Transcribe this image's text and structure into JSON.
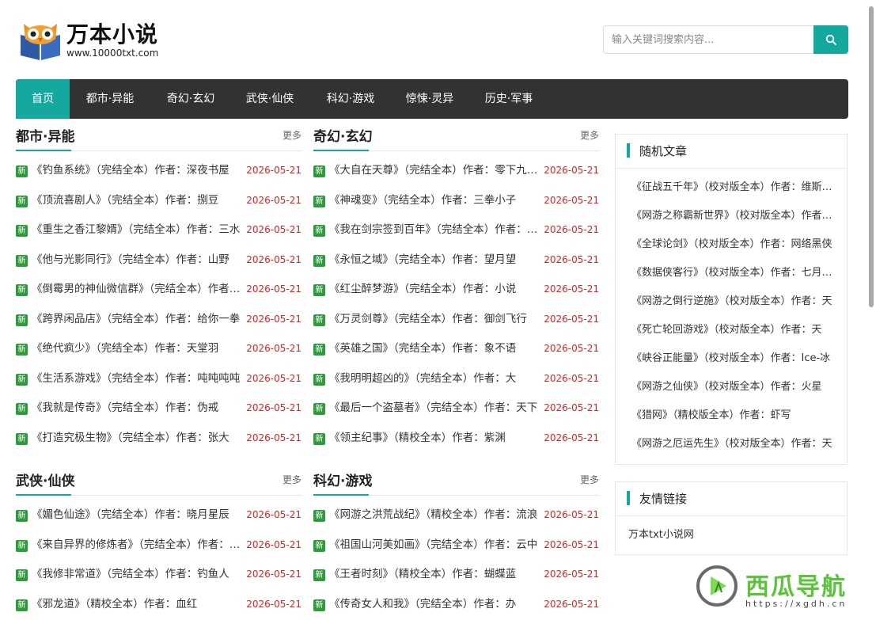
{
  "site": {
    "name": "万本小说",
    "url": "www.10000txt.com",
    "search_placeholder": "输入关键词搜索内容..."
  },
  "nav": [
    "首页",
    "都市·异能",
    "奇幻·玄幻",
    "武侠·仙侠",
    "科幻·游戏",
    "惊悚·灵异",
    "历史·军事"
  ],
  "more_label": "更多",
  "badge_label": "新",
  "sections": [
    {
      "title": "都市·异能",
      "items": [
        {
          "title": "《钓鱼系统》（完结全本）作者：深夜书屋",
          "date": "2026-05-21"
        },
        {
          "title": "《顶流喜剧人》（完结全本）作者：捌豆",
          "date": "2026-05-21"
        },
        {
          "title": "《重生之香江黎婿》（完结全本）作者：三水",
          "date": "2026-05-21"
        },
        {
          "title": "《他与光影同行》（完结全本）作者：山野",
          "date": "2026-05-21"
        },
        {
          "title": "《倒霉男的神仙微信群》（完结全本）作者：小",
          "date": "2026-05-21"
        },
        {
          "title": "《跨界闲品店》（完结全本）作者：给你一拳",
          "date": "2026-05-21"
        },
        {
          "title": "《绝代疯少》（完结全本）作者：天堂羽",
          "date": "2026-05-21"
        },
        {
          "title": "《生活系游戏》（完结全本）作者：吨吨吨吨",
          "date": "2026-05-21"
        },
        {
          "title": "《我就是传奇》（完结全本）作者：伪戒",
          "date": "2026-05-21"
        },
        {
          "title": "《打造究极生物》（完结全本）作者：张大",
          "date": "2026-05-21"
        }
      ]
    },
    {
      "title": "奇幻·玄幻",
      "items": [
        {
          "title": "《大自在天尊》（完结全本）作者：零下九十度",
          "date": "2026-05-21"
        },
        {
          "title": "《神魂变》（完结全本）作者：三拳小子",
          "date": "2026-05-21"
        },
        {
          "title": "《我在剑宗签到百年》（完结全本）作者：白菜",
          "date": "2026-05-21"
        },
        {
          "title": "《永恒之域》（完结全本）作者：望月望",
          "date": "2026-05-21"
        },
        {
          "title": "《红尘醉梦游》（完结全本）作者：小说",
          "date": "2026-05-21"
        },
        {
          "title": "《万灵剑尊》（完结全本）作者：御剑飞行",
          "date": "2026-05-21"
        },
        {
          "title": "《英雄之国》（完结全本）作者：象不语",
          "date": "2026-05-21"
        },
        {
          "title": "《我明明超凶的》（完结全本）作者：大",
          "date": "2026-05-21"
        },
        {
          "title": "《最后一个盗墓者》（完结全本）作者：天下",
          "date": "2026-05-21"
        },
        {
          "title": "《领主纪事》（精校全本）作者：紫渊",
          "date": "2026-05-21"
        }
      ]
    },
    {
      "title": "武侠·仙侠",
      "items": [
        {
          "title": "《媚色仙途》（完结全本）作者：晓月星辰",
          "date": "2026-05-21"
        },
        {
          "title": "《来自异界的修炼者》（完结全本）作者：佚名",
          "date": "2026-05-21"
        },
        {
          "title": "《我修非常道》（完结全本）作者：钓鱼人",
          "date": "2026-05-21"
        },
        {
          "title": "《邪龙道》（精校全本）作者：血红",
          "date": "2026-05-21"
        }
      ]
    },
    {
      "title": "科幻·游戏",
      "items": [
        {
          "title": "《网游之洪荒战纪》（精校全本）作者：流浪",
          "date": "2026-05-21"
        },
        {
          "title": "《祖国山河美如画》（完结全本）作者：云中",
          "date": "2026-05-21"
        },
        {
          "title": "《王者时刻》（精校全本）作者：蝴蝶蓝",
          "date": "2026-05-21"
        },
        {
          "title": "《传奇女人和我》（完结全本）作者：办",
          "date": "2026-05-21"
        }
      ]
    }
  ],
  "random": {
    "title": "随机文章",
    "items": [
      "《征战五千年》（校对版全本）作者：维斯特洛",
      "《网游之称霸新世界》（校对版全本）作者：天",
      "《全球论剑》（校对版全本）作者：网络黑侠",
      "《数据侠客行》（校对版全本）作者：七月新番",
      "《网游之倒行逆施》（校对版全本）作者：天",
      "《死亡轮回游戏》（校对版全本）作者：天",
      "《峡谷正能量》（校对版全本）作者：Ice-冰",
      "《网游之仙侠》（校对版全本）作者：火星",
      "《猎网》（精校版全本）作者：虾写",
      "《网游之厄运先生》（校对版全本）作者：天"
    ]
  },
  "links": {
    "title": "友情链接",
    "items": [
      "万本txt小说网"
    ]
  },
  "watermark": {
    "name": "西瓜导航",
    "url": "https://xgdh.cn"
  },
  "colors": {
    "accent": "#14a89f",
    "nav_bg": "#323232",
    "date": "#dd2222",
    "badge": "#2e9a3b"
  }
}
